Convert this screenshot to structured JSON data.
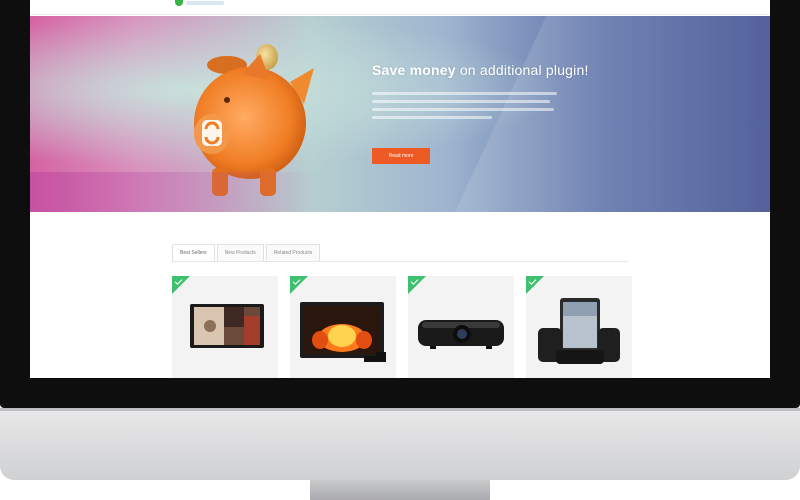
{
  "hero": {
    "title_bold": "Save money",
    "title_light": "on additional plugin!",
    "cta_label": "Read more"
  },
  "tabs": [
    {
      "label": "Best Sellers",
      "active": true
    },
    {
      "label": "New Products",
      "active": false
    },
    {
      "label": "Related Products",
      "active": false
    }
  ],
  "products": [
    {
      "name": "tablet",
      "badge_color": "#3fbf6f"
    },
    {
      "name": "tv-fireplace",
      "badge_color": "#3fbf6f"
    },
    {
      "name": "projector",
      "badge_color": "#3fbf6f"
    },
    {
      "name": "ipad-dock",
      "badge_color": "#3fbf6f"
    }
  ],
  "colors": {
    "cta": "#ee5a24",
    "badge": "#3fbf6f",
    "brand_logo": "#37b34a"
  }
}
